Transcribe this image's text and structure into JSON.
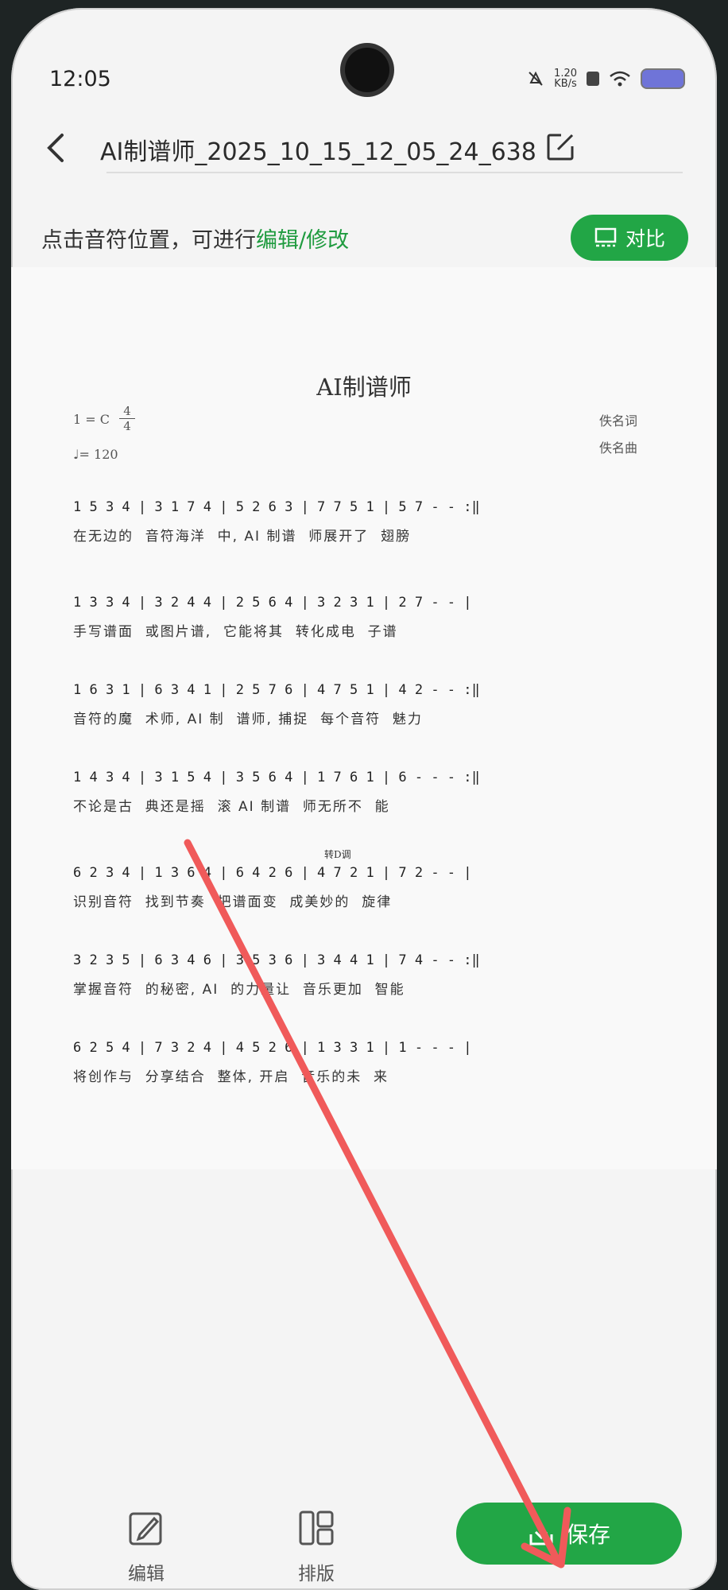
{
  "status": {
    "time": "12:05",
    "net_speed": "1.20\nKB/s"
  },
  "header": {
    "title": "AI制谱师_2025_10_15_12_05_24_638"
  },
  "hint": {
    "prefix": "点击音符位置，可进行",
    "highlight": "编辑/修改"
  },
  "compare_button": {
    "label": "对比"
  },
  "sheet": {
    "title": "AI制谱师",
    "key": "1 = C",
    "time_sig_top": "4",
    "time_sig_bottom": "4",
    "tempo": "♩= 120",
    "lyricist": "佚名词",
    "composer": "佚名曲",
    "rows": [
      {
        "notes": "1 5 3 4 | 3 1 7 4 | 5 2 6 3 | 7 7 5 1 | 5 7 - - :‖",
        "lyrics": "在无边的  音符海洋  中, AI 制谱  师展开了  翅膀"
      },
      {
        "notes": "1 3 3 4 | 3 2 4 4 | 2 5 6 4 | 3 2 3 1 | 2 7 - - |",
        "lyrics": "手写谱面  或图片谱,  它能将其  转化成电  子谱"
      },
      {
        "notes": "1 6 3 1 | 6 3 4 1 | 2 5 7 6 | 4 7 5 1 | 4 2 - - :‖",
        "lyrics": "音符的魔  术师, AI 制  谱师, 捕捉  每个音符  魅力"
      },
      {
        "notes": "1 4 3 4 | 3 1 5 4 | 3 5 6 4 | 1 7 6 1 | 6 - - - :‖",
        "lyrics": "不论是古  典还是摇  滚 AI 制谱  师无所不  能"
      },
      {
        "notes": "6 2 3 4 | 1 3 6 4 | 6 4 2 6 | 4 7 2 1 | 7 2 - - |",
        "lyrics": "识别音符  找到节奏  把谱面变  成美妙的  旋律"
      },
      {
        "notes": "3 2 3 5 | 6 3 4 6 | 3 5 3 6 | 3 4 4 1 | 7 4 - - :‖",
        "lyrics": "掌握音符  的秘密, AI  的力量让  音乐更加  智能"
      },
      {
        "notes": "6 2 5 4 | 7 3 2 4 | 4 5 2 6 | 1 3 3 1 | 1 - - - |",
        "lyrics": "将创作与  分享结合  整体, 开启  音乐的未  来"
      }
    ],
    "annotation": "转D调"
  },
  "toolbar": {
    "edit_label": "编辑",
    "layout_label": "排版",
    "save_label": "保存"
  },
  "colors": {
    "accent": "#22a646",
    "arrow": "#f05a5a"
  }
}
